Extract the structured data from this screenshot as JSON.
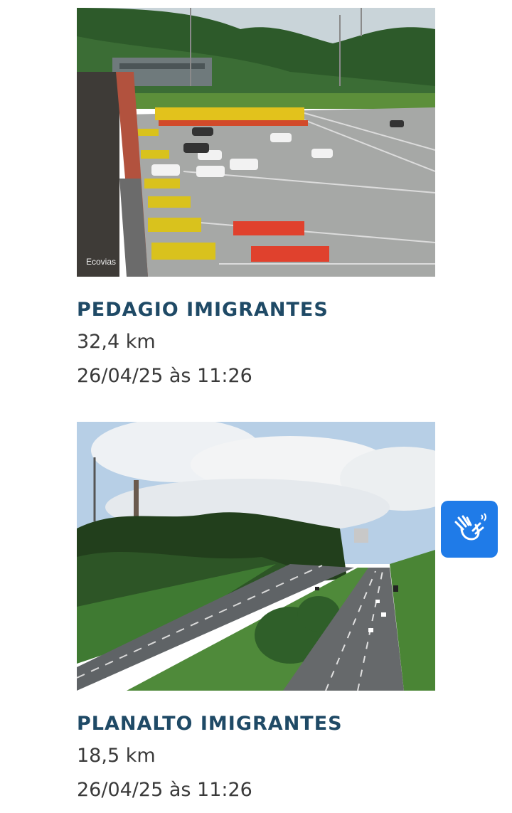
{
  "cameras": [
    {
      "title": "PEDAGIO IMIGRANTES",
      "distance": "32,4 km",
      "timestamp": "26/04/25 às 11:26",
      "watermark": "Ecovias"
    },
    {
      "title": "PLANALTO IMIGRANTES",
      "distance": "18,5 km",
      "timestamp": "26/04/25 às 11:26"
    }
  ],
  "accessibility_button": {
    "icon": "sign-language-hands-icon",
    "color": "#1f7be8"
  }
}
